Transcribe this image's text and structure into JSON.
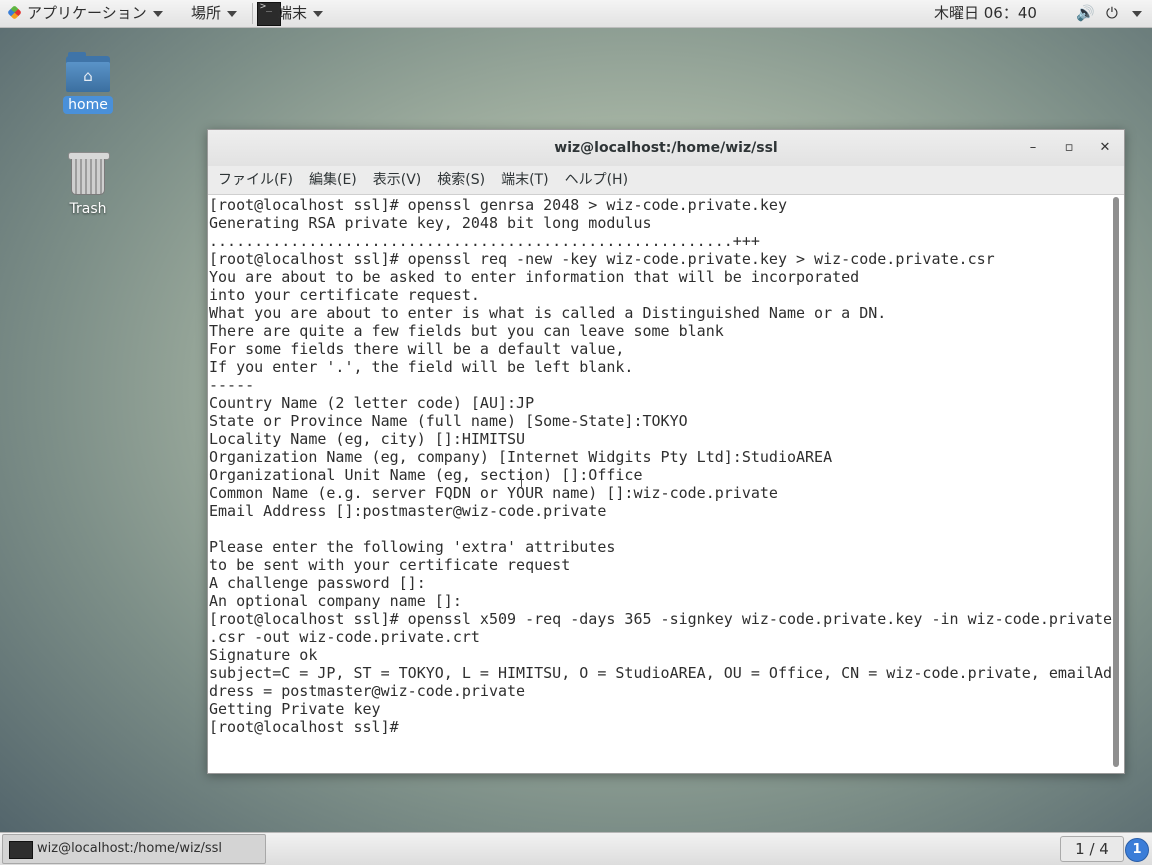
{
  "top_panel": {
    "applications": "アプリケーション",
    "places": "場所",
    "terminal_task": "端末",
    "clock": "木曜日 06：40"
  },
  "desktop": {
    "home_label": "home",
    "trash_label": "Trash"
  },
  "window": {
    "title": "wiz@localhost:/home/wiz/ssl",
    "menu": [
      "ファイル(F)",
      "編集(E)",
      "表示(V)",
      "検索(S)",
      "端末(T)",
      "ヘルプ(H)"
    ]
  },
  "terminal": {
    "lines": [
      "[root@localhost ssl]# openssl genrsa 2048 > wiz-code.private.key",
      "Generating RSA private key, 2048 bit long modulus",
      "..........................................................+++",
      "[root@localhost ssl]# openssl req -new -key wiz-code.private.key > wiz-code.private.csr",
      "You are about to be asked to enter information that will be incorporated",
      "into your certificate request.",
      "What you are about to enter is what is called a Distinguished Name or a DN.",
      "There are quite a few fields but you can leave some blank",
      "For some fields there will be a default value,",
      "If you enter '.', the field will be left blank.",
      "-----",
      "Country Name (2 letter code) [AU]:JP",
      "State or Province Name (full name) [Some-State]:TOKYO",
      "Locality Name (eg, city) []:HIMITSU",
      "Organization Name (eg, company) [Internet Widgits Pty Ltd]:StudioAREA",
      "Organizational Unit Name (eg, section) []:Office",
      "Common Name (e.g. server FQDN or YOUR name) []:wiz-code.private",
      "Email Address []:postmaster@wiz-code.private",
      "",
      "Please enter the following 'extra' attributes",
      "to be sent with your certificate request",
      "A challenge password []:",
      "An optional company name []:",
      "[root@localhost ssl]# openssl x509 -req -days 365 -signkey wiz-code.private.key -in wiz-code.private",
      ".csr -out wiz-code.private.crt",
      "Signature ok",
      "subject=C = JP, ST = TOKYO, L = HIMITSU, O = StudioAREA, OU = Office, CN = wiz-code.private, emailAd",
      "dress = postmaster@wiz-code.private",
      "Getting Private key",
      "[root@localhost ssl]# "
    ]
  },
  "bottom_panel": {
    "task_label": "wiz@localhost:/home/wiz/ssl",
    "workspace": "1 / 4",
    "notifications": "1"
  }
}
